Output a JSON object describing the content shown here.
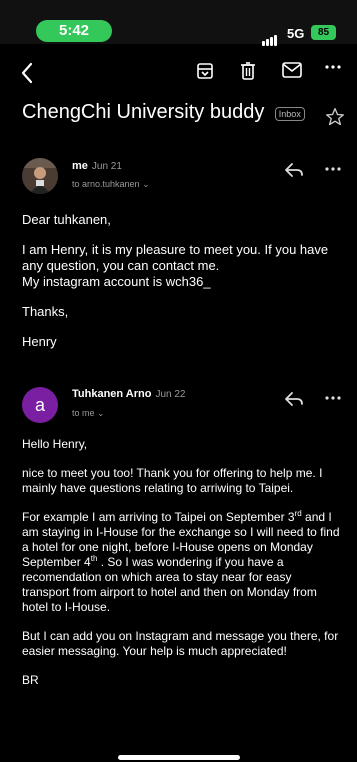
{
  "status_bar": {
    "time": "5:42",
    "network": "5G",
    "battery": "85"
  },
  "toolbar": {
    "icons": [
      "back-icon",
      "archive-icon",
      "delete-icon",
      "mail-icon",
      "more-icon"
    ]
  },
  "subject": {
    "title": "ChengChi University buddy",
    "label": "Inbox"
  },
  "messages": [
    {
      "sender": "me",
      "date": "Jun 21",
      "to": "to arno.tuhkanen",
      "body": {
        "greeting": "Dear tuhkanen,",
        "p1_line1": "I am Henry, it is my pleasure to meet you. If you have any question, you can contact me.",
        "p1_line2": "My instagram account is wch36_",
        "thanks": "Thanks,",
        "sign": "Henry"
      }
    },
    {
      "avatar_letter": "a",
      "sender": "Tuhkanen Arno",
      "date": "Jun 22",
      "to": "to me",
      "body": {
        "greeting": "Hello Henry,",
        "p1": "nice to meet you too! Thank you for offering to help me. I mainly have questions relating to arriwing to Taipei.",
        "p2_a": "For example I am arriving to Taipei on September 3",
        "p2_sup1": "rd",
        "p2_b": " and I am staying in I-House for the exchange so I will need to find a hotel for one night, before I-House opens on Monday September 4",
        "p2_sup2": "th",
        "p2_c": " . So I was wondering if you have a recomendation on which area to stay near for easy transport from airport to hotel and then on Monday from hotel to I-House.",
        "p3": "But I can add you on Instagram and message you there, for easier messaging. Your help is much appreciated!",
        "closing": "BR"
      }
    }
  ]
}
